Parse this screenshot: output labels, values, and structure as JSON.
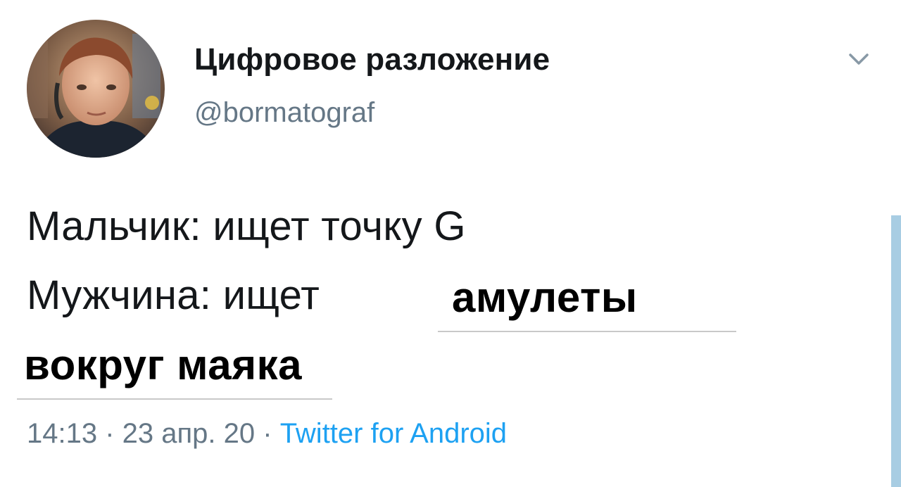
{
  "author": {
    "display_name": "Цифровое разложение",
    "handle": "@bormatograf"
  },
  "tweet": {
    "line1": "Мальчик: ищет точку G",
    "line2_prefix": "Мужчина: ищет",
    "pasted_line1": "амулеты",
    "pasted_line2": "вокруг маяка"
  },
  "meta": {
    "time": "14:13",
    "separator1": " · ",
    "date": "23 апр. 20",
    "separator2": " · ",
    "source": "Twitter for Android"
  },
  "icons": {
    "menu": "chevron-down-icon"
  },
  "colors": {
    "text": "#14171a",
    "secondary": "#657786",
    "link": "#1da1f2",
    "scroll_accent": "#a8cde3"
  }
}
